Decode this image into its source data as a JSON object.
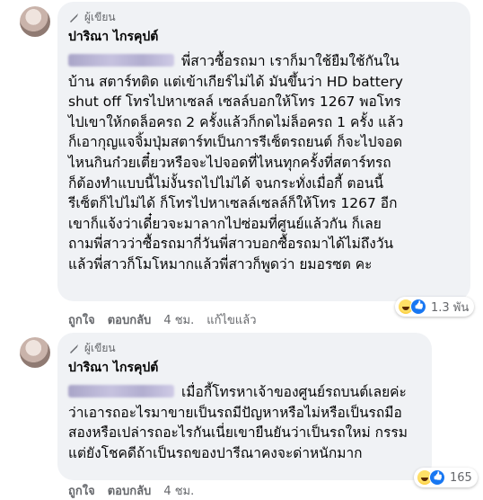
{
  "comments": [
    {
      "author_badge": "ผู้เขียน",
      "author_name": "ปาริณา ไกรคุปต์",
      "lines": [
        "พี่สาวซื้อรถมา เราก็มาใช้ยืมใช้กันใน",
        "บ้าน สตาร์ทติด แต่เข้าเกียร์ไม่ได้ มันขึ้นว่า HD battery",
        "shut off โทรไปหาเซลล์ เซลล์บอกให้โทร 1267 พอโทร",
        "ไปเขาให้กดล็อครถ 2 ครั้งแล้วก็กดไม่ล็อครถ 1 ครั้ง แล้ว",
        "ก็เอากุญแจจิ้มปุ่มสตาร์ทเป็นการรีเซ็ตรถยนต์ ก็จะไปจอด",
        "ไหนกินก๋วยเตี๋ยวหรือจะไปจอดที่ไหนทุกครั้งที่สตาร์ทรถ",
        "ก็ต้องทำแบบนี้ไม่งั้นรถไปไม่ได้ จนกระทั่งเมื่อกี้ ตอนนี้",
        "รีเซ็ตก็ไปไม่ได้ ก็โทรไปหาเซลล์เซลล์ก็ให้โทร 1267 อีก",
        "เขาก็แจ้งว่าเดี๋ยวจะมาลากไปซ่อมที่ศูนย์แล้วกัน ก็เลย",
        "ถามพี่สาวว่าซื้อรถมากี่วันพี่สาวบอกซื้อรถมาได้ไม่ถึงวัน",
        "แล้วพี่สาวก็โมโหมากแล้วพี่สาวก็พูดว่า ยมอรซต คะ"
      ],
      "reaction_count": "1.3 พัน",
      "actions": {
        "like": "ถูกใจ",
        "reply": "ตอบกลับ",
        "time": "4 ชม.",
        "edited": "แก้ไขแล้ว"
      }
    },
    {
      "author_badge": "ผู้เขียน",
      "author_name": "ปาริณา ไกรคุปต์",
      "lines": [
        "เมื่อกี้โทรหาเจ้าของศูนย์รถบนต์เลยค่ะ",
        "ว่าเอารถอะไรมาขายเป็นรถมีปัญหาหรือไม่หรือเป็นรถมือ",
        "สองหรือเปล่ารถอะไรกันเนี่ยเขายืนยันว่าเป็นรถใหม่ กรรม",
        "แต่ยังโชคดีถ้าเป็นรถของปารีณาคงจะด่าหนักมาก"
      ],
      "reaction_count": "165",
      "actions": {
        "like": "ถูกใจ",
        "reply": "ตอบกลับ",
        "time": "4 ชม."
      }
    }
  ]
}
